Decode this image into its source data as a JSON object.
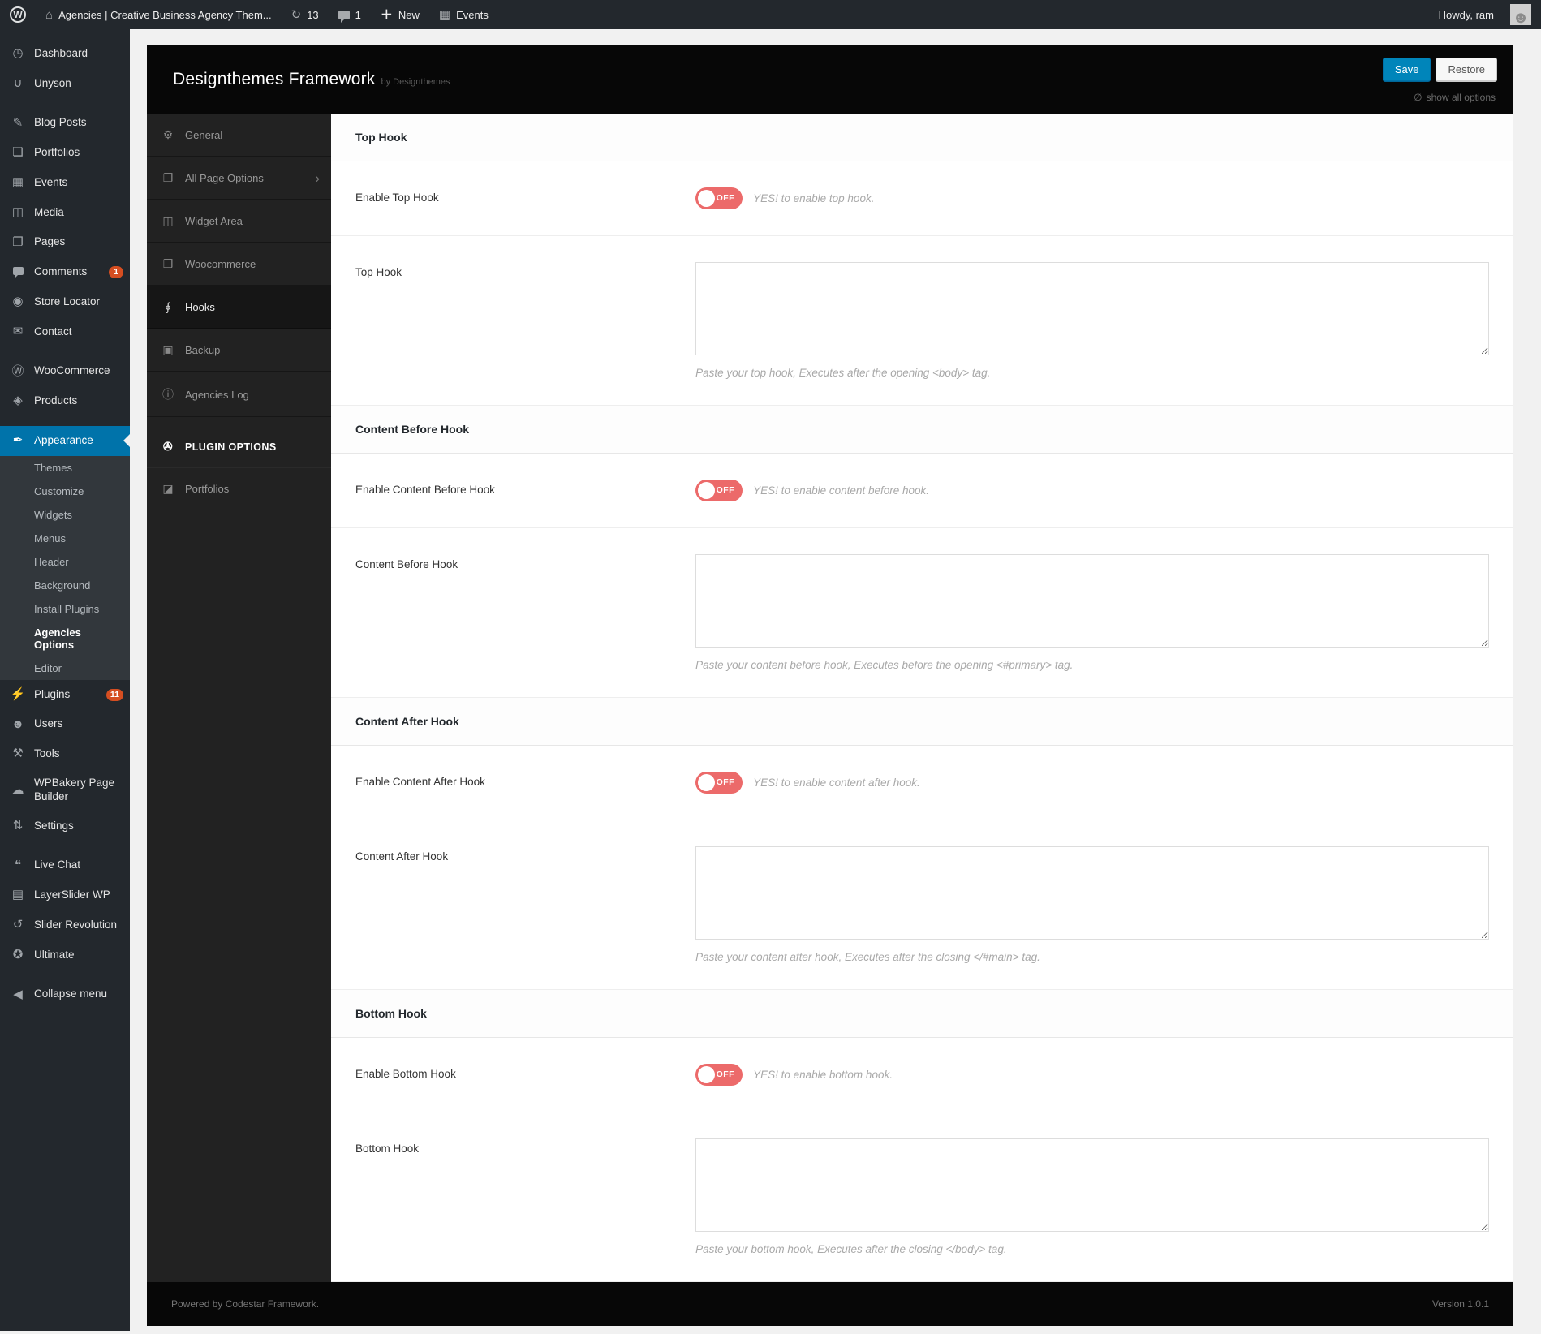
{
  "admin_bar": {
    "site_name": "Agencies | Creative Business Agency Them...",
    "updates_count": "13",
    "comments_count": "1",
    "new_label": "New",
    "events_label": "Events",
    "howdy": "Howdy, ram"
  },
  "sidebar": {
    "items": [
      {
        "label": "Dashboard",
        "glyph": "◷",
        "icon": "dashboard-icon"
      },
      {
        "label": "Unyson",
        "glyph": "∪",
        "icon": "unyson-icon"
      },
      {
        "separator": true
      },
      {
        "label": "Blog Posts",
        "glyph": "✎",
        "icon": "pushpin-icon"
      },
      {
        "label": "Portfolios",
        "glyph": "❏",
        "icon": "portfolio-icon"
      },
      {
        "label": "Events",
        "glyph": "▦",
        "icon": "calendar-icon"
      },
      {
        "label": "Media",
        "glyph": "◫",
        "icon": "media-icon"
      },
      {
        "label": "Pages",
        "glyph": "❐",
        "icon": "pages-icon"
      },
      {
        "label": "Comments",
        "glyph": "bubble",
        "icon": "comment-bubble-icon",
        "badge": "1"
      },
      {
        "label": "Store Locator",
        "glyph": "◉",
        "icon": "location-pin-icon"
      },
      {
        "label": "Contact",
        "glyph": "✉",
        "icon": "envelope-icon"
      },
      {
        "separator": true
      },
      {
        "label": "WooCommerce",
        "glyph": "Ⓦ",
        "icon": "woocommerce-icon"
      },
      {
        "label": "Products",
        "glyph": "◈",
        "icon": "products-cube-icon"
      },
      {
        "separator": true
      },
      {
        "label": "Appearance",
        "glyph": "✒",
        "icon": "paintbrush-icon",
        "active": true,
        "submenu": [
          {
            "label": "Themes"
          },
          {
            "label": "Customize"
          },
          {
            "label": "Widgets"
          },
          {
            "label": "Menus"
          },
          {
            "label": "Header"
          },
          {
            "label": "Background"
          },
          {
            "label": "Install Plugins"
          },
          {
            "label": "Agencies Options",
            "current": true
          },
          {
            "label": "Editor"
          }
        ]
      },
      {
        "label": "Plugins",
        "glyph": "⚡",
        "icon": "plug-icon",
        "badge": "11"
      },
      {
        "label": "Users",
        "glyph": "☻",
        "icon": "user-icon"
      },
      {
        "label": "Tools",
        "glyph": "⚒",
        "icon": "wrench-icon"
      },
      {
        "label": "WPBakery Page Builder",
        "glyph": "☁",
        "icon": "wpbakery-icon"
      },
      {
        "label": "Settings",
        "glyph": "⇅",
        "icon": "sliders-icon"
      },
      {
        "separator": true
      },
      {
        "label": "Live Chat",
        "glyph": "❝",
        "icon": "chat-bubbles-icon"
      },
      {
        "label": "LayerSlider WP",
        "glyph": "▤",
        "icon": "layers-icon"
      },
      {
        "label": "Slider Revolution",
        "glyph": "↺",
        "icon": "slider-revolution-icon"
      },
      {
        "label": "Ultimate",
        "glyph": "✪",
        "icon": "ultimate-badge-icon"
      },
      {
        "separator": true
      },
      {
        "label": "Collapse menu",
        "glyph": "◀",
        "icon": "collapse-arrow-icon"
      }
    ]
  },
  "panel": {
    "title": "Designthemes Framework",
    "byline": "by Designthemes",
    "save_label": "Save",
    "restore_label": "Restore",
    "show_all_label": "show all options",
    "nav": [
      {
        "label": "General",
        "glyph": "⚙",
        "icon": "gear-icon"
      },
      {
        "label": "All Page Options",
        "glyph": "❐",
        "icon": "copy-pages-icon",
        "chevron": "›"
      },
      {
        "label": "Widget Area",
        "glyph": "◫",
        "icon": "widget-book-icon"
      },
      {
        "label": "Woocommerce",
        "glyph": "❒",
        "icon": "cart-icon"
      },
      {
        "label": "Hooks",
        "glyph": "∮",
        "icon": "paperclip-icon",
        "active": true
      },
      {
        "label": "Backup",
        "glyph": "▣",
        "icon": "shield-icon"
      },
      {
        "label": "Agencies Log",
        "glyph": "ⓘ",
        "icon": "info-icon"
      }
    ],
    "plugin_options": {
      "label": "PLUGIN OPTIONS",
      "glyph": "✇",
      "icon": "plug-options-icon"
    },
    "plugin_nav": [
      {
        "label": "Portfolios",
        "glyph": "◪",
        "icon": "image-icon"
      }
    ],
    "sections": [
      {
        "title": "Top Hook",
        "toggle": {
          "label": "Enable Top Hook",
          "state": "OFF",
          "desc": "YES! to enable top hook."
        },
        "field": {
          "label": "Top Hook",
          "value": "",
          "hint": "Paste your top hook, Executes after the opening <body> tag."
        }
      },
      {
        "title": "Content Before Hook",
        "toggle": {
          "label": "Enable Content Before Hook",
          "state": "OFF",
          "desc": "YES! to enable content before hook."
        },
        "field": {
          "label": "Content Before Hook",
          "value": "",
          "hint": "Paste your content before hook, Executes before the opening <#primary> tag."
        }
      },
      {
        "title": "Content After Hook",
        "toggle": {
          "label": "Enable Content After Hook",
          "state": "OFF",
          "desc": "YES! to enable content after hook."
        },
        "field": {
          "label": "Content After Hook",
          "value": "",
          "hint": "Paste your content after hook, Executes after the closing </#main> tag."
        }
      },
      {
        "title": "Bottom Hook",
        "toggle": {
          "label": "Enable Bottom Hook",
          "state": "OFF",
          "desc": "YES! to enable bottom hook."
        },
        "field": {
          "label": "Bottom Hook",
          "value": "",
          "hint": "Paste your bottom hook, Executes after the closing </body> tag."
        }
      }
    ],
    "footer_left": "Powered by Codestar Framework.",
    "footer_right": "Version 1.0.1"
  },
  "colors": {
    "sidebar_active_blue": "#0073aa",
    "save_button_blue": "#0085ba",
    "toggle_off_red": "#ec6a6a",
    "badge_orange_red": "#d54e21",
    "admin_dark": "#23282d"
  }
}
